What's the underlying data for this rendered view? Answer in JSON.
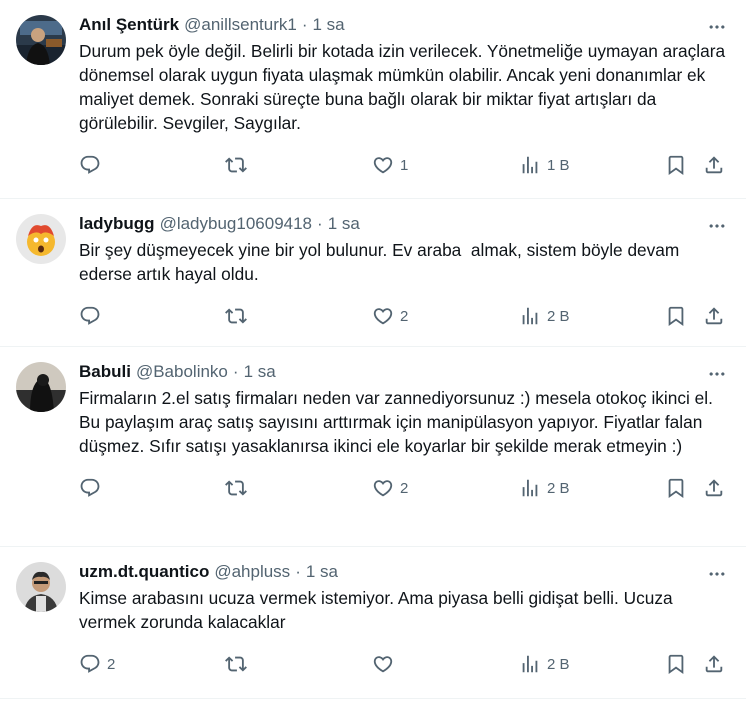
{
  "tweets": [
    {
      "name": "Anıl Şentürk",
      "handle": "@anillsenturk1",
      "time": "1 sa",
      "text": "Durum pek öyle değil. Belirli bir kotada izin verilecek. Yönetmeliğe uymayan araçlara dönemsel olarak uygun fiyata ulaşmak mümkün olabilir. Ancak yeni donanımlar ek maliyet demek. Sonraki süreçte buna bağlı olarak bir miktar fiyat artışları da görülebilir. Sevgiler, Saygılar.",
      "replies": "",
      "reposts": "",
      "likes": "1",
      "views": "1 B"
    },
    {
      "name": "ladybugg",
      "handle": "@ladybug10609418",
      "time": "1 sa",
      "text": "Bir şey düşmeyecek yine bir yol bulunur. Ev araba  almak, sistem böyle devam ederse artık hayal oldu.",
      "replies": "",
      "reposts": "",
      "likes": "2",
      "views": "2 B"
    },
    {
      "name": "Babuli",
      "handle": "@Babolinko",
      "time": "1 sa",
      "text": "Firmaların 2.el satış firmaları neden var zannediyorsunuz :) mesela otokoç ikinci el. Bu paylaşım araç satış sayısını arttırmak için manipülasyon yapıyor. Fiyatlar falan düşmez. Sıfır satışı yasaklanırsa ikinci ele koyarlar bir şekilde merak etmeyin :)",
      "replies": "",
      "reposts": "",
      "likes": "2",
      "views": "2 B"
    },
    {
      "name": "uzm.dt.quantico",
      "handle": "@ahpluss",
      "time": "1 sa",
      "text": "Kimse arabasını ucuza vermek istemiyor. Ama piyasa belli gidişat belli. Ucuza vermek zorunda kalacaklar",
      "replies": "2",
      "reposts": "",
      "likes": "",
      "views": "2 B"
    }
  ],
  "icons": {
    "reply": "reply-icon",
    "repost": "repost-icon",
    "like": "heart-icon",
    "views": "views-icon",
    "bookmark": "bookmark-icon",
    "share": "share-icon",
    "more": "more-icon"
  },
  "colors": {
    "text": "#0f1419",
    "secondary": "#536471",
    "divider": "#eff3f4"
  }
}
